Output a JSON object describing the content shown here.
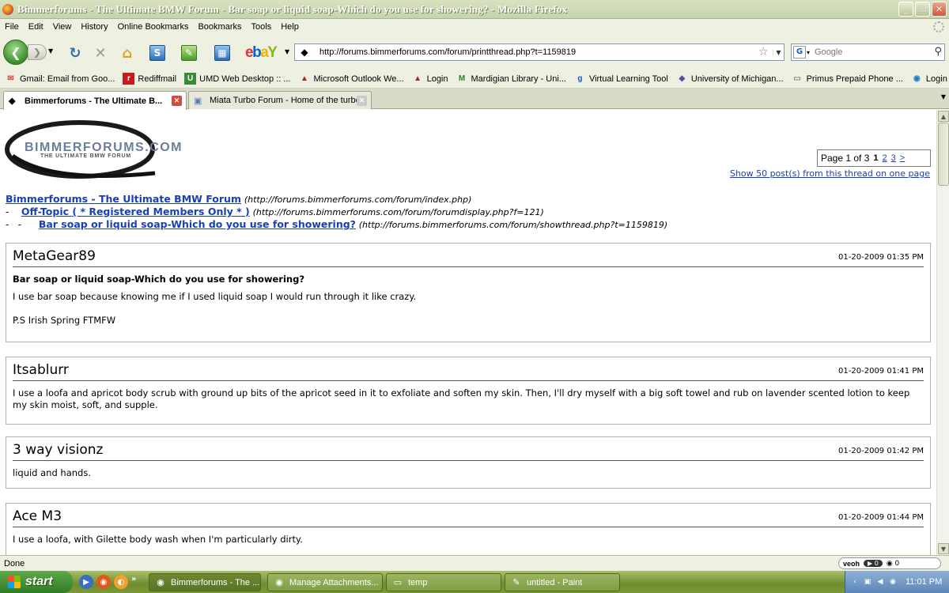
{
  "window": {
    "title": "Bimmerforums - The Ultimate BMW Forum - Bar soap or liquid soap-Which do you use for showering? - Mozilla Firefox",
    "buttons": [
      "_",
      "❐",
      "✕"
    ]
  },
  "menu": [
    "File",
    "Edit",
    "View",
    "History",
    "Online Bookmarks",
    "Bookmarks",
    "Tools",
    "Help"
  ],
  "toolbar": {
    "url": "http://forums.bimmerforums.com/forum/printthread.php?t=1159819",
    "search_placeholder": "Google",
    "ebay_logo": "ebY"
  },
  "bookmarks": [
    {
      "label": "Gmail: Email from Goo...",
      "icon": "gmail-icon"
    },
    {
      "label": "Rediffmail",
      "icon": "rediff-icon"
    },
    {
      "label": "UMD Web Desktop :: ...",
      "icon": "umd-icon"
    },
    {
      "label": "Microsoft Outlook We...",
      "icon": "outlook-icon"
    },
    {
      "label": "Login",
      "icon": "login-icon"
    },
    {
      "label": "Mardigian Library - Uni...",
      "icon": "library-icon"
    },
    {
      "label": "Virtual Learning Tool",
      "icon": "google-icon"
    },
    {
      "label": "University of Michigan...",
      "icon": "umich-icon"
    },
    {
      "label": "Primus Prepaid Phone ...",
      "icon": "page-icon"
    },
    {
      "label": "Login Verification",
      "icon": "login-verify-icon"
    }
  ],
  "tabs": [
    {
      "label": "Bimmerforums - The Ultimate B...",
      "active": true
    },
    {
      "label": "Miata Turbo Forum - Home of the turbo...",
      "active": false
    }
  ],
  "page": {
    "logo_text": "BIMMERFORUMS.COM",
    "logo_tagline": "THE ULTIMATE BMW FORUM",
    "pagination": {
      "text": "Page 1 of 3",
      "current": "1",
      "pages": [
        "2",
        "3",
        ">"
      ]
    },
    "show_all": "Show 50 post(s) from this thread on one page",
    "breadcrumbs": [
      {
        "prefix": "",
        "link": "Bimmerforums - The Ultimate BMW Forum",
        "url": "(http://forums.bimmerforums.com/forum/index.php)"
      },
      {
        "prefix": "-",
        "link": "Off-Topic ( * Registered Members Only * )",
        "url": "(http://forums.bimmerforums.com/forum/forumdisplay.php?f=121)"
      },
      {
        "prefix": "-   -",
        "link": "Bar soap or liquid soap-Which do you use for showering?",
        "url": "(http://forums.bimmerforums.com/forum/showthread.php?t=1159819)"
      }
    ],
    "posts": [
      {
        "user": "MetaGear89",
        "date": "01-20-2009 01:35 PM",
        "title": "Bar soap or liquid soap-Which do you use for showering?",
        "body": [
          "I use bar soap because knowing me if I used liquid soap I would run through it like crazy.",
          "P.S Irish Spring FTMFW"
        ]
      },
      {
        "user": "Itsablurr",
        "date": "01-20-2009 01:41 PM",
        "title": "",
        "body": [
          "I use a loofa and apricot body scrub with ground up bits of the apricot seed in it to exfoliate and soften my skin. Then, I'll dry myself with a big soft towel and rub on lavender scented lotion to keep my skin moist, soft, and supple."
        ]
      },
      {
        "user": "3 way visionz",
        "date": "01-20-2009 01:42 PM",
        "title": "",
        "body": [
          "liquid and hands."
        ]
      },
      {
        "user": "Ace M3",
        "date": "01-20-2009 01:44 PM",
        "title": "",
        "body": [
          "I use a loofa, with Gilette body wash when I'm particularly dirty."
        ]
      }
    ]
  },
  "statusbar": {
    "status": "Done",
    "veoh_label": "veoh",
    "veoh_counts": [
      "0",
      "0"
    ]
  },
  "taskbar": {
    "start": "start",
    "tasks": [
      {
        "label": "Bimmerforums - The ...",
        "icon": "firefox-icon",
        "active": true
      },
      {
        "label": "Manage Attachments...",
        "icon": "firefox-icon",
        "active": false
      },
      {
        "label": "temp",
        "icon": "folder-icon",
        "active": false
      },
      {
        "label": "untitled - Paint",
        "icon": "paint-icon",
        "active": false
      }
    ],
    "clock": "11:01 PM"
  },
  "colors": {
    "link": "#1a3fb5",
    "title_bar": "#c7d3ac",
    "taskbar": "#7c9a36"
  }
}
